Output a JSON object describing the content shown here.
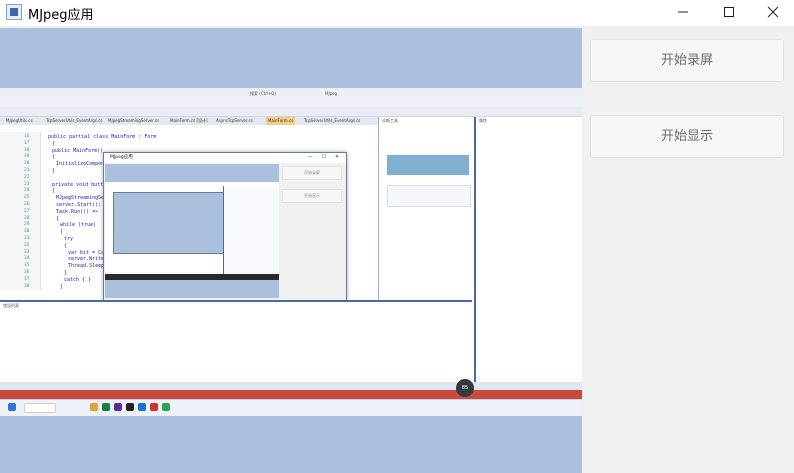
{
  "window": {
    "title": "MJpeg应用",
    "controls": {
      "minimize": "—",
      "maximize": "☐",
      "close": "✕"
    }
  },
  "buttons": {
    "record": "开始录屏",
    "display": "开始显示"
  },
  "preview": {
    "vs_search": "搜索 (Ctrl+Q)",
    "vs_project": "MJpeg",
    "tabs": [
      "MJpegUtils.cs",
      "TcpServerUtils_EventArgs.cs",
      "MJpegStreamingServer.cs",
      "MainForm.cs [设计]",
      "AsyncTcpServer.cs",
      "MainForm.cs",
      "TcpServerUtils_EventArgs.cs"
    ],
    "code_lines": [
      {
        "n": "16",
        "t": "public partial class MainForm : Form"
      },
      {
        "n": "17",
        "t": "{"
      },
      {
        "n": "18",
        "t": "public MainForm()"
      },
      {
        "n": "19",
        "t": "{"
      },
      {
        "n": "20",
        "t": "InitializeComponent"
      },
      {
        "n": "21",
        "t": "}"
      },
      {
        "n": "22",
        "t": ""
      },
      {
        "n": "23",
        "t": "private void button1_C"
      },
      {
        "n": "24",
        "t": "{"
      },
      {
        "n": "25",
        "t": "MJpegStreamingServ"
      },
      {
        "n": "26",
        "t": "server.Start();"
      },
      {
        "n": "27",
        "t": "Task.Run(() =>"
      },
      {
        "n": "28",
        "t": "{"
      },
      {
        "n": "29",
        "t": "while (true)"
      },
      {
        "n": "30",
        "t": "{"
      },
      {
        "n": "31",
        "t": "try"
      },
      {
        "n": "32",
        "t": "{"
      },
      {
        "n": "33",
        "t": "var bit = Captu"
      },
      {
        "n": "34",
        "t": "server.Write("
      },
      {
        "n": "35",
        "t": "Thread.Sleep("
      },
      {
        "n": "36",
        "t": "}"
      },
      {
        "n": "37",
        "t": "catch { }"
      },
      {
        "n": "38",
        "t": "}"
      }
    ],
    "inner_window_title": "MJpeg应用",
    "inner_buttons": [
      "开始录屏",
      "开始显示"
    ],
    "diag_title": "诊断工具",
    "props_title": "属性",
    "output_title": "错误列表",
    "badge": "85"
  }
}
